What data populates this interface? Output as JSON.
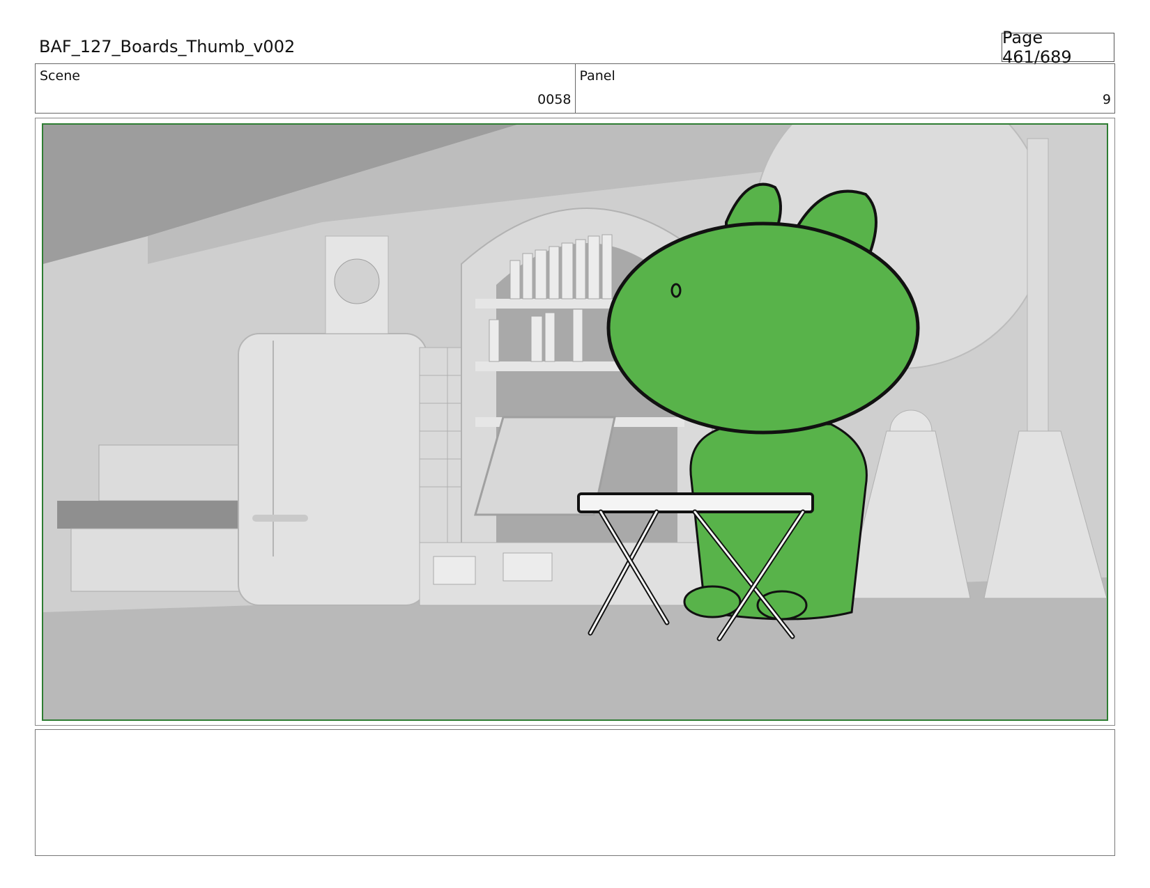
{
  "header": {
    "document_title": "BAF_127_Boards_Thumb_v002",
    "page_indicator": "Page 461/689"
  },
  "scene": {
    "label": "Scene",
    "value": "0058"
  },
  "panel": {
    "label": "Panel",
    "value": "9"
  },
  "artwork": {
    "frame_color": "#2e7d32",
    "character_color": "#58b34a",
    "background_tone": "#c8c8c8"
  },
  "notes": {
    "text": ""
  }
}
